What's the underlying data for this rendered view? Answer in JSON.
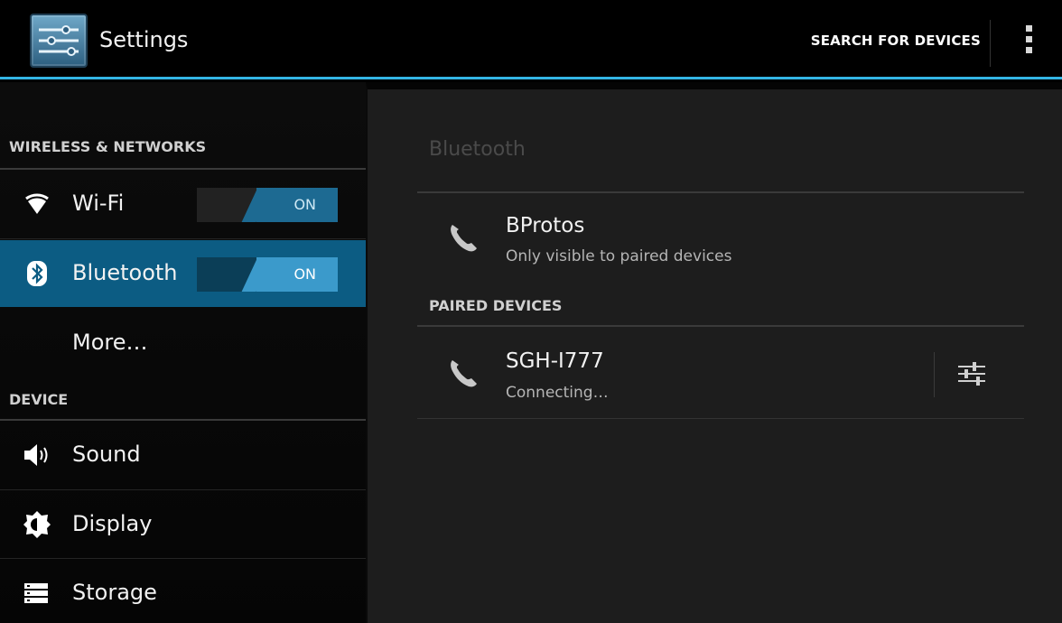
{
  "action_bar": {
    "title": "Settings",
    "app_icon": "settings-sliders-icon",
    "search_button": "SEARCH FOR DEVICES",
    "overflow_icon": "overflow-menu-icon",
    "accent_color": "#33b5e5"
  },
  "sidebar": {
    "sections": [
      {
        "header": "WIRELESS & NETWORKS",
        "items": [
          {
            "label": "Wi-Fi",
            "icon": "wifi-icon",
            "toggle": "ON",
            "selected": false
          },
          {
            "label": "Bluetooth",
            "icon": "bluetooth-icon",
            "toggle": "ON",
            "selected": true
          },
          {
            "label": "More…",
            "icon": "",
            "selected": false
          }
        ]
      },
      {
        "header": "DEVICE",
        "items": [
          {
            "label": "Sound",
            "icon": "speaker-icon",
            "selected": false
          },
          {
            "label": "Display",
            "icon": "brightness-icon",
            "selected": false
          },
          {
            "label": "Storage",
            "icon": "storage-icon",
            "selected": false
          }
        ]
      }
    ],
    "selected_color": "#0c5c83"
  },
  "detail": {
    "title": "Bluetooth",
    "local_device": {
      "name": "BProtos",
      "status": "Only visible to paired devices",
      "icon": "phone-icon"
    },
    "paired_header": "PAIRED DEVICES",
    "paired_devices": [
      {
        "name": "SGH-I777",
        "status": "Connecting…",
        "icon": "phone-icon",
        "settings_icon": "device-settings-icon"
      }
    ]
  }
}
